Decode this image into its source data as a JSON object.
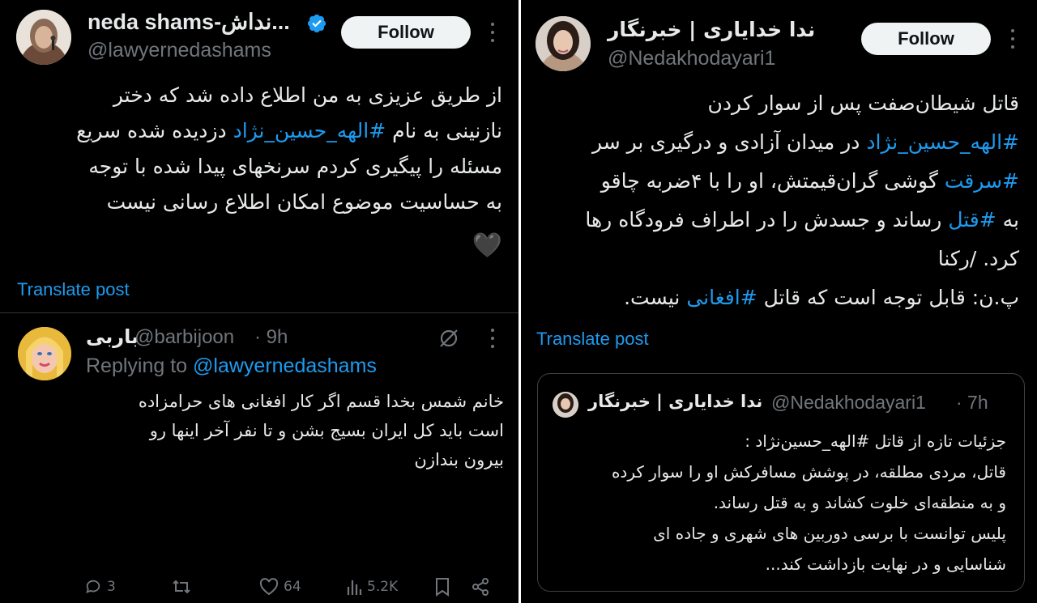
{
  "left": {
    "tweet": {
      "name": "neda shams-نداش...",
      "handle": "@lawyernedashams",
      "follow_label": "Follow",
      "body_lines": [
        [
          {
            "t": "از طریق عزیزی به من اطلاع داده شد که دختر"
          }
        ],
        [
          {
            "t": "نازنینی به نام "
          },
          {
            "t": "#الهه_حسین_نژاد",
            "tag": true
          },
          {
            "t": " دزدیده شده سریع"
          }
        ],
        [
          {
            "t": "مسئله را پیگیری کردم سرنخهای  پیدا شده با توجه"
          }
        ],
        [
          {
            "t": "به حساسیت موضوع امکان اطلاع رسانی نیست"
          }
        ]
      ],
      "emoji": "🖤",
      "translate_label": "Translate post"
    },
    "reply": {
      "name": "باربی",
      "handle": "@barbijoon",
      "time": "· 9h",
      "replying_to_prefix": "Replying to ",
      "replying_to_handle": "@lawyernedashams",
      "body_lines": [
        "خانم شمس بخدا قسم اگر کار افغانی های حرامزاده",
        "است باید کل ایران بسیج بشن و تا نفر آخر اینها رو",
        "بیرون بندازن"
      ],
      "actions": {
        "replies": "3",
        "likes": "64",
        "views": "5.2K"
      },
      "icons": [
        "reply-icon",
        "retweet-icon",
        "like-icon",
        "views-icon",
        "bookmark-icon",
        "share-icon",
        "grok-icon"
      ]
    }
  },
  "right": {
    "tweet": {
      "name": "ندا خدایاری | خبرنگار",
      "handle": "@Nedakhodayari1",
      "follow_label": "Follow",
      "body_lines": [
        [
          {
            "t": "قاتل شیطان‌صفت پس از سوار کردن"
          }
        ],
        [
          {
            "t": "#الهه_حسین_نژاد",
            "tag": true
          },
          {
            "t": " در میدان آزادی و درگیری بر سر"
          }
        ],
        [
          {
            "t": "#سرقت",
            "tag": true
          },
          {
            "t": " گوشی گران‌قیمتش، او را با ۴ضربه چاقو"
          }
        ],
        [
          {
            "t": "به "
          },
          {
            "t": "#قتل",
            "tag": true
          },
          {
            "t": " رساند و جسدش را در اطراف فرودگاه رها"
          }
        ],
        [
          {
            "t": "کرد. /رکنا"
          }
        ],
        [
          {
            "t": "پ.ن: قابل توجه است که قاتل "
          },
          {
            "t": "#افغانی",
            "tag": true
          },
          {
            "t": " نیست."
          }
        ]
      ],
      "translate_label": "Translate post"
    },
    "quote": {
      "name": "ندا خدایاری | خبرنگار",
      "handle": "@Nedakhodayari1",
      "time": "· 7h",
      "body_lines": [
        "جزئیات تازه از قاتل #الهه_حسین‌نژاد :",
        "قاتل، مردی مطلقه، در پوشش مسافرکش او را سوار کرده",
        "و به منطقه‌ای خلوت کشاند و به قتل رساند.",
        "پلیس توانست با برسی دوربین های شهری و جاده ای",
        "شناسایی و در نهایت بازداشت کند..."
      ]
    }
  },
  "colors": {
    "background": "#000000",
    "text": "#e7e9ea",
    "muted": "#71767b",
    "link": "#1d9bf0",
    "follow_bg": "#eff3f4",
    "verified": "#1d9bf0"
  }
}
